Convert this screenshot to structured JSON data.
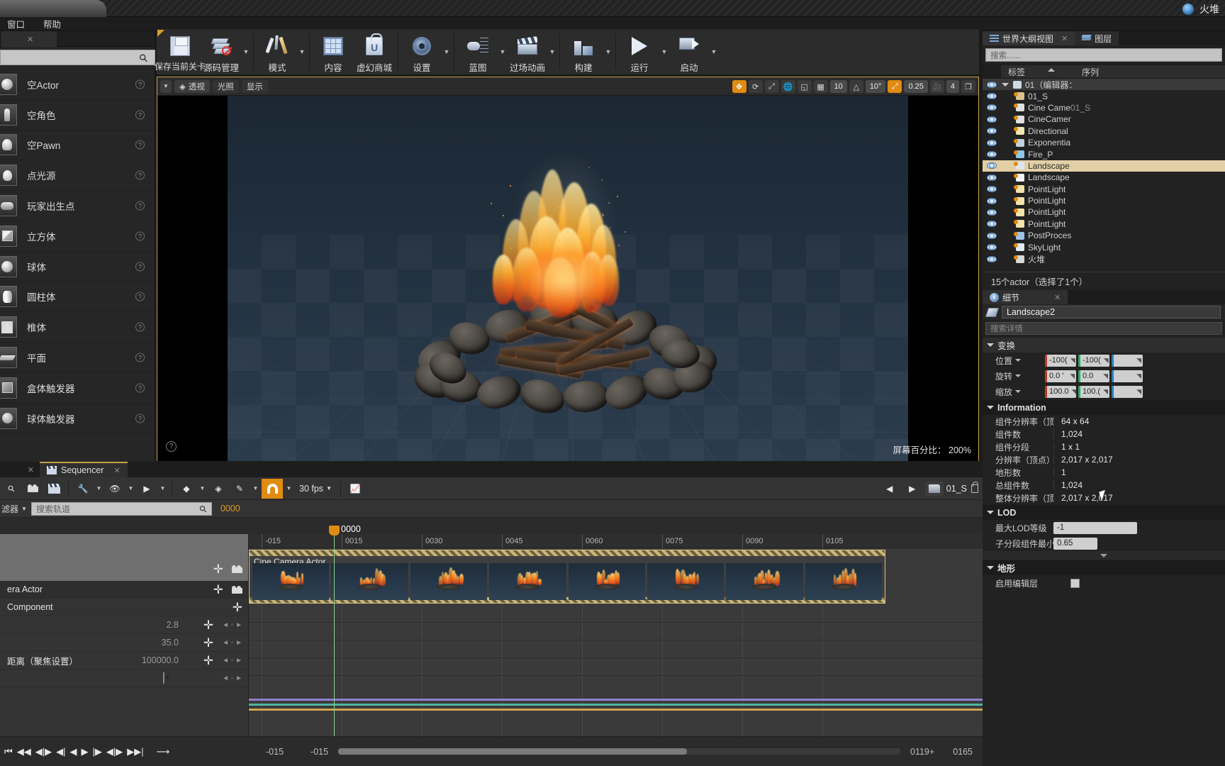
{
  "titlebar": {
    "project_name": "火堆"
  },
  "menubar": {
    "items": [
      "窗口",
      "帮助"
    ]
  },
  "placement": {
    "search_placeholder": "",
    "items": [
      {
        "label": "空Actor",
        "icon": "sphere-icon"
      },
      {
        "label": "空角色",
        "icon": "character-icon"
      },
      {
        "label": "空Pawn",
        "icon": "pawn-icon"
      },
      {
        "label": "点光源",
        "icon": "pointlight-icon"
      },
      {
        "label": "玩家出生点",
        "icon": "playerstart-icon"
      },
      {
        "label": "立方体",
        "icon": "cube-icon"
      },
      {
        "label": "球体",
        "icon": "sphere-icon"
      },
      {
        "label": "圆柱体",
        "icon": "cylinder-icon"
      },
      {
        "label": "椎体",
        "icon": "cone-icon"
      },
      {
        "label": "平面",
        "icon": "plane-icon"
      },
      {
        "label": "盒体触发器",
        "icon": "box-trigger-icon"
      },
      {
        "label": "球体触发器",
        "icon": "sphere-trigger-icon"
      }
    ]
  },
  "toolbar": {
    "buttons": [
      {
        "label": "保存当前关卡",
        "icon": "save-icon",
        "has_dropdown": false
      },
      {
        "label": "源码管理",
        "icon": "source-control-icon",
        "has_dropdown": true
      },
      {
        "label": "模式",
        "icon": "modes-icon",
        "has_dropdown": true
      },
      {
        "label": "内容",
        "icon": "content-browser-icon",
        "has_dropdown": false
      },
      {
        "label": "虚幻商城",
        "icon": "marketplace-icon",
        "has_dropdown": false
      },
      {
        "label": "设置",
        "icon": "settings-gear-icon",
        "has_dropdown": true
      },
      {
        "label": "蓝图",
        "icon": "blueprint-icon",
        "has_dropdown": true
      },
      {
        "label": "过场动画",
        "icon": "cinematics-icon",
        "has_dropdown": true
      },
      {
        "label": "构建",
        "icon": "build-icon",
        "has_dropdown": true
      },
      {
        "label": "运行",
        "icon": "play-icon",
        "has_dropdown": true
      },
      {
        "label": "启动",
        "icon": "launch-icon",
        "has_dropdown": true
      }
    ]
  },
  "viewport": {
    "chips": [
      "透视",
      "光照",
      "显示"
    ],
    "grid_snap_value": "10",
    "rotation_snap_value": "10°",
    "scale_snap_value": "0.25",
    "camera_speed_value": "4",
    "screen_percentage_label": "屏幕百分比：",
    "screen_percentage_value": "200%"
  },
  "outliner": {
    "tabs": [
      {
        "label": "世界大纲视图",
        "icon": "outliner-icon",
        "selected": true
      },
      {
        "label": "图层",
        "icon": "layers-icon",
        "selected": false
      }
    ],
    "search_placeholder": "搜索......",
    "columns": [
      "标签",
      "序列"
    ],
    "rows": [
      {
        "name": "01（编辑器：",
        "indent": 0,
        "root": true,
        "selected": false,
        "icon": "level-icon"
      },
      {
        "name": "01_S",
        "indent": 1,
        "selected": false,
        "icon": "sequence-icon"
      },
      {
        "name": "Cine Came",
        "name_dim": "01_S",
        "indent": 1,
        "selected": false,
        "icon": "camera-icon"
      },
      {
        "name": "CineCamer",
        "indent": 1,
        "selected": false,
        "icon": "camera-icon"
      },
      {
        "name": "Directional",
        "indent": 1,
        "selected": false,
        "icon": "dirlight-icon"
      },
      {
        "name": "Exponentia",
        "indent": 1,
        "selected": false,
        "icon": "fog-icon"
      },
      {
        "name": "Fire_P",
        "indent": 1,
        "selected": false,
        "icon": "particle-icon"
      },
      {
        "name": "Landscape",
        "indent": 1,
        "selected": true,
        "icon": "landscape-icon"
      },
      {
        "name": "Landscape",
        "indent": 1,
        "selected": false,
        "icon": "sphere-icon"
      },
      {
        "name": "PointLight",
        "indent": 1,
        "selected": false,
        "icon": "pointlight-icon"
      },
      {
        "name": "PointLight",
        "indent": 1,
        "selected": false,
        "icon": "pointlight-icon"
      },
      {
        "name": "PointLight",
        "indent": 1,
        "selected": false,
        "icon": "pointlight-icon"
      },
      {
        "name": "PointLight",
        "indent": 1,
        "selected": false,
        "icon": "pointlight-icon"
      },
      {
        "name": "PostProces",
        "indent": 1,
        "selected": false,
        "icon": "postprocess-icon"
      },
      {
        "name": "SkyLight",
        "indent": 1,
        "selected": false,
        "icon": "skylight-icon"
      },
      {
        "name": "火堆",
        "indent": 1,
        "selected": false,
        "icon": "blueprint-actor-icon"
      }
    ],
    "status": "15个actor（选择了1个）"
  },
  "details": {
    "tab_label": "细节",
    "actor_name": "Landscape2",
    "search_placeholder": "搜索详情",
    "transform": {
      "title": "变换",
      "rows": [
        {
          "label": "位置",
          "x": "-100(",
          "y": "-100(",
          "z": ""
        },
        {
          "label": "旋转",
          "x": "0.0 '",
          "y": "0.0",
          "z": ""
        },
        {
          "label": "缩放",
          "x": "100.0",
          "y": "100.(",
          "z": ""
        }
      ]
    },
    "information": {
      "title": "Information",
      "rows": [
        {
          "label": "组件分辨率（顶",
          "value": "64 x 64"
        },
        {
          "label": "组件数",
          "value": "1,024"
        },
        {
          "label": "组件分段",
          "value": "1 x 1"
        },
        {
          "label": "分辨率（顶点）",
          "value": "2,017 x 2,017"
        },
        {
          "label": "地形数",
          "value": "1"
        },
        {
          "label": "总组件数",
          "value": "1,024"
        },
        {
          "label": "整体分辨率（顶",
          "value": "2,017 x 2,017"
        }
      ]
    },
    "lod": {
      "title": "LOD",
      "rows": [
        {
          "label": "最大LOD等级",
          "value": "-1"
        },
        {
          "label": "子分段组件最小",
          "value": "0.65"
        }
      ]
    },
    "terrain": {
      "title": "地形",
      "rows": [
        {
          "label": "启用编辑层",
          "value": ""
        }
      ]
    }
  },
  "sequencer": {
    "tab_label": "Sequencer",
    "fps_label": "30 fps",
    "sequence_name": "01_S",
    "filter_label": "滤器",
    "track_search_placeholder": "搜索轨道",
    "current_frame_label": "0000",
    "playhead_frame": "0000",
    "tracks": [
      {
        "label": "",
        "type": "master"
      },
      {
        "label": "era Actor",
        "type": "actor"
      },
      {
        "label": "Component",
        "type": "component"
      },
      {
        "label": "",
        "value": "2.8",
        "type": "property"
      },
      {
        "label": "",
        "value": "35.0",
        "type": "property"
      },
      {
        "label": "距离（聚焦设置）",
        "value": "100000.0",
        "type": "property"
      },
      {
        "label": "",
        "value": "",
        "type": "checkbox"
      }
    ],
    "section_label": "Cine Camera Actor",
    "ruler_ticks": [
      "-015",
      "0015",
      "0030",
      "0045",
      "0060",
      "0075",
      "0090",
      "0105"
    ],
    "bottom_left_time": "-015",
    "bottom_right_time": "-015",
    "range_start": "0119+",
    "range_end": "0165"
  }
}
